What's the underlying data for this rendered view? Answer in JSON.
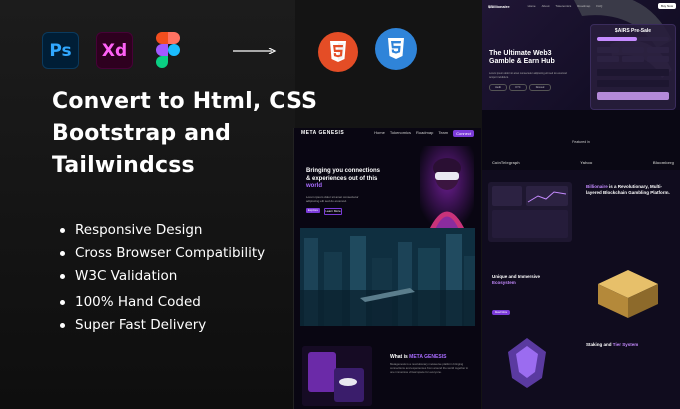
{
  "left_panel": {
    "tool_icons": [
      {
        "label": "Ps",
        "icon": "photoshop-icon",
        "color": "#31a8ff"
      },
      {
        "label": "Xd",
        "icon": "adobe-xd-icon",
        "color": "#ff61f6"
      },
      {
        "icon": "figma-icon"
      }
    ],
    "target_icons": [
      {
        "label": "HTML",
        "icon": "html5-icon",
        "color": "#e44d26"
      },
      {
        "label": "CSS",
        "icon": "css3-icon",
        "color": "#2f84d9"
      }
    ],
    "headline": [
      "Convert to Html, CSS",
      "Bootstrap and",
      "Tailwindcss"
    ],
    "features": [
      "Responsive Design",
      "Cross Browser Compatibility",
      "W3C Validation",
      "100% Hand Coded",
      "Super Fast Delivery"
    ]
  },
  "mockup_metagenesis": {
    "logo": "META GENESIS",
    "nav_links": [
      "Home",
      "Tokenomics",
      "Roadmap",
      "Team"
    ],
    "nav_button": "Connect",
    "hero_title_lines": [
      "Bringing you connections",
      "& experiences out of this"
    ],
    "hero_title_accent": "world",
    "hero_sub": "Lorem ipsum dolor sit amet consectetur adipiscing elit sed do eiusmod.",
    "hero_buttons": [
      "Explore",
      "Learn More"
    ],
    "about_title": "What is",
    "about_title_accent": "META GENESIS",
    "about_text": "Metagenesis is a revolutionary metaverse platform bringing connections and experiences from around the world together in one immersive virtual space for everyone."
  },
  "mockup_web3": {
    "logo": "$Billionaire",
    "nav_links": [
      "Home",
      "About",
      "Tokenomics",
      "Roadmap",
      "FAQ"
    ],
    "nav_button": "Buy Now",
    "hero_title_lines": [
      "The Ultimate Web3",
      "Gamble & Earn Hub"
    ],
    "hero_sub": "Lorem ipsum dolor sit amet consectetur adipiscing elit sed do eiusmod tempor incididunt.",
    "chips": [
      "Audit",
      "KYC",
      "Doxxed"
    ],
    "presale_title": "$AIRS Pre-Sale",
    "featured_title": "Featured in",
    "featured_logos": [
      "CoinTelegraph",
      "Yahoo",
      "Bloomberg"
    ],
    "section1_title": "Billionaire",
    "section1_title_rest": " is a Revolutionary, Multi-layered Blockchain Gambling Platform.",
    "section2_title": "Unique and Immersive",
    "section2_title_accent": "Ecosystem",
    "section3_title": "Staking and",
    "section3_title_accent": "Tier System",
    "read_more": "Read More",
    "colors": {
      "accent": "#7b3bd9",
      "highlight": "#c58bff"
    }
  }
}
